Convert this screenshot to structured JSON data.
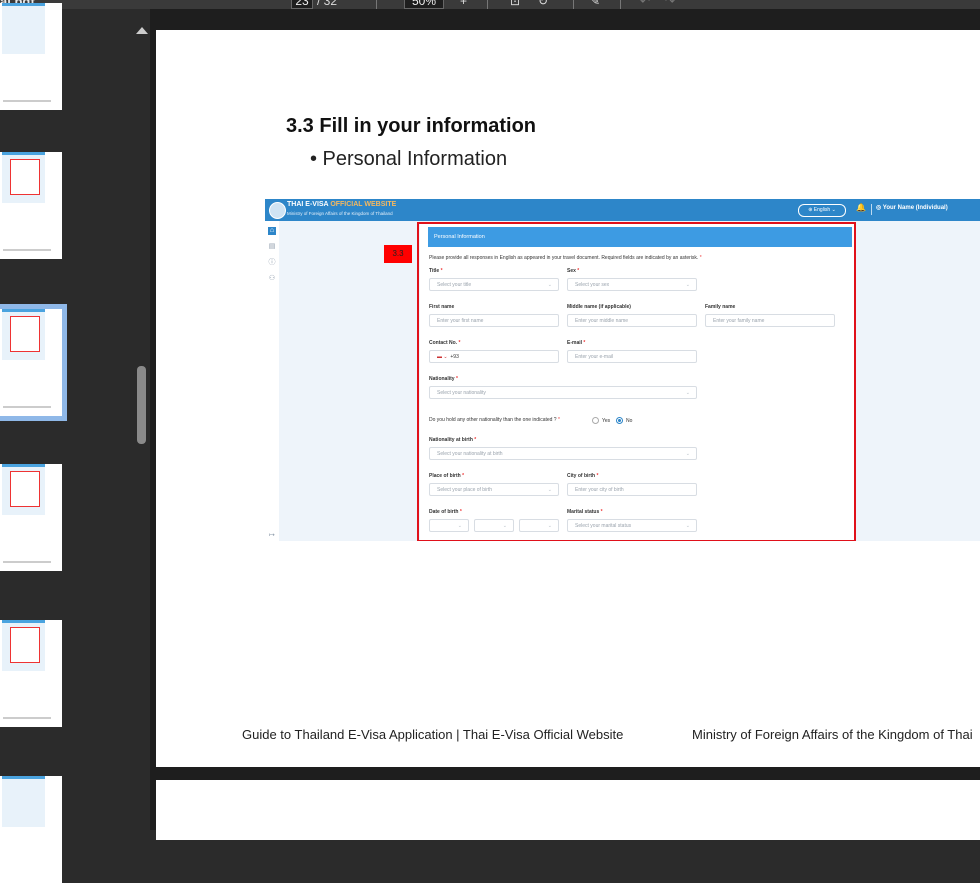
{
  "toolbar": {
    "file_name": "al.pdf",
    "page_current": "23",
    "page_total": "/ 32",
    "zoom": "50%",
    "zoom_in": "+",
    "fit_label": "⊡",
    "rotate_label": "↻",
    "draw_label": "✎",
    "undo_label": "↶",
    "redo_label": "↷"
  },
  "document": {
    "heading": "3.3 Fill in your information",
    "bullet": "• Personal Information",
    "footer_left": "Guide to Thailand E-Visa Application | Thai E-Visa Official Website",
    "footer_right": "Ministry of Foreign Affairs of the Kingdom of Thai"
  },
  "site": {
    "brand_white": "THAI E-VISA ",
    "brand_accent": "OFFICIAL WEBSITE",
    "subtitle": "Ministry of Foreign Affairs of the Kingdom of Thailand",
    "language": "⊕ English ⌄",
    "bell": "🔔",
    "user": "◎ Your Name (Individual)",
    "badge": "3.3",
    "side_icons": [
      "⌂",
      "▤",
      "ⓘ",
      "⚇"
    ],
    "collapse": "↦"
  },
  "form": {
    "section_title": "Personal Information",
    "note": "Please provide all responses in English as appeared in your travel document. Required fields are indicated by an asterisk.",
    "required_mark": "*",
    "title_label": "Title",
    "title_placeholder": "Select your title",
    "sex_label": "Sex",
    "sex_placeholder": "Select your sex",
    "first_label": "First name",
    "first_placeholder": "Enter your first name",
    "middle_label": "Middle name (if applicable)",
    "middle_placeholder": "Enter your middle name",
    "family_label": "Family name",
    "family_placeholder": "Enter your family name",
    "contact_label": "Contact No.",
    "contact_code": "+93",
    "contact_flag": "▬ ⌄",
    "email_label": "E-mail",
    "email_placeholder": "Enter your e-mail",
    "nationality_label": "Nationality",
    "nationality_placeholder": "Select your nationality",
    "other_nat_question": "Do you hold any other nationality than the one indicated ?",
    "radio_yes": "Yes",
    "radio_no": "No",
    "birth_nat_label": "Nationality at birth",
    "birth_nat_placeholder": "Select your nationality at birth",
    "place_birth_label": "Place of birth",
    "place_birth_placeholder": "Select your place of birth",
    "city_birth_label": "City of birth",
    "city_birth_placeholder": "Enter your city of birth",
    "dob_label": "Date of birth",
    "marital_label": "Marital status",
    "marital_placeholder": "Select your marital status",
    "chevron": "⌄"
  },
  "colors": {
    "accent": "#2d86c9",
    "highlight": "#e0101a"
  }
}
